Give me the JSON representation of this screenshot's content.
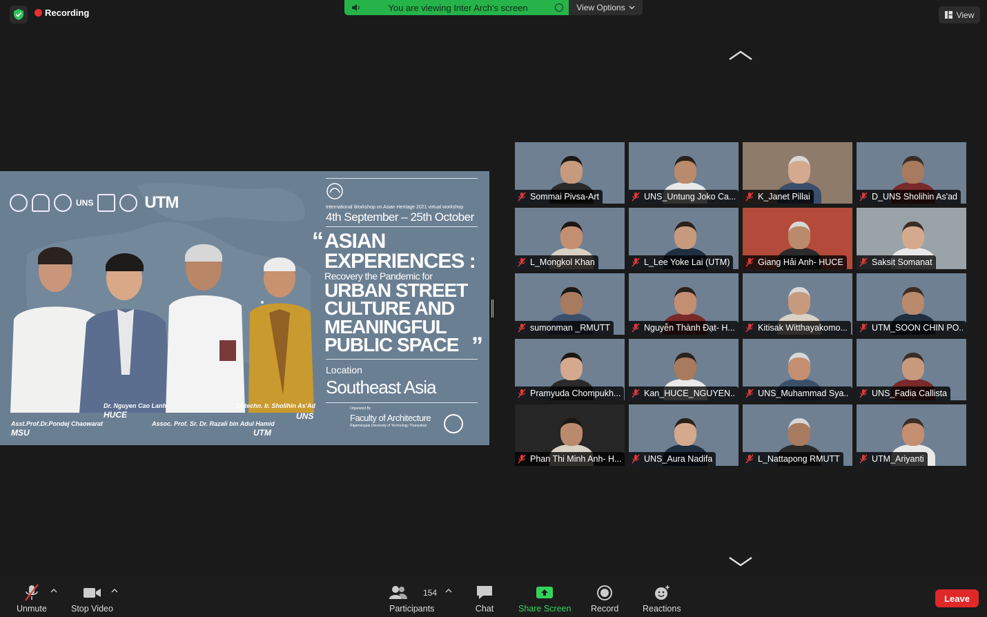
{
  "top": {
    "recording_label": "Recording",
    "share_banner": "You are viewing Inter Arch's screen",
    "view_options": "View Options",
    "view_button": "View"
  },
  "slide": {
    "logo_uns": "UNS",
    "logo_utm": "UTM",
    "workshop_line": "International Workshop on Asian Heritage 2021 virtual workshop",
    "date_start": "4th September",
    "date_sep": "–",
    "date_end": "25th October",
    "title_line1": "ASIAN",
    "title_line2": "EXPERIENCES :",
    "subtitle": "Recovery the Pandemic for",
    "title_line3": "URBAN STREET",
    "title_line4": "CULTURE AND",
    "title_line5": "MEANINGFUL",
    "title_line6": "PUBLIC SPACE",
    "quote_open": "“",
    "quote_close": "”",
    "location_label": "Location",
    "location_value": "Southeast Asia",
    "organized_by": "Organized By",
    "faculty": "Faculty of Architecture",
    "university": "Rajamangala University of Technology Thanyaburi",
    "speakers": [
      {
        "name": "Dr. Nguyen Cao Lanh",
        "org": "HUCE"
      },
      {
        "name": "Dr.techn. Ir. Sholihin As'Ad",
        "org": "UNS"
      },
      {
        "name": "Asst.Prof.Dr.Pondej Chaowarat",
        "org": "MSU"
      },
      {
        "name": "Assoc. Prof. Sr. Dr. Razali bin Adul Hamid",
        "org": "UTM"
      }
    ]
  },
  "participants": [
    {
      "name": "Sommai Pivsa-Art"
    },
    {
      "name": "UNS_Untung Joko Ca..."
    },
    {
      "name": "K_Janet Pillai"
    },
    {
      "name": "D_UNS Sholihin As'ad"
    },
    {
      "name": "L_Mongkol Khan"
    },
    {
      "name": "L_Lee Yoke Lai (UTM)"
    },
    {
      "name": "Giang Hải Anh- HUCE"
    },
    {
      "name": "Saksit Somanat"
    },
    {
      "name": "sumonman _RMUTT"
    },
    {
      "name": "Nguyễn Thành Đạt- H..."
    },
    {
      "name": "Kitisak Witthayakomo..."
    },
    {
      "name": "UTM_SOON CHIN PO..."
    },
    {
      "name": "Pramyuda Chompukh..."
    },
    {
      "name": "Kan_HUCE_NGUYEN..."
    },
    {
      "name": "UNS_Muhammad Sya..."
    },
    {
      "name": "UNS_Fadia Callista"
    },
    {
      "name": "Phan Thi Minh Anh- H..."
    },
    {
      "name": "UNS_Aura Nadifa"
    },
    {
      "name": "L_Nattapong RMUTT"
    },
    {
      "name": "UTM_Ariyanti"
    }
  ],
  "toolbar": {
    "unmute": "Unmute",
    "stop_video": "Stop Video",
    "participants": "Participants",
    "participants_count": "154",
    "chat": "Chat",
    "share_screen": "Share Screen",
    "record": "Record",
    "reactions": "Reactions",
    "leave": "Leave"
  },
  "colors": {
    "share_green": "#26b34a",
    "leave_red": "#e02828",
    "recording_red": "#e8312f",
    "slide_bg": "#6b7f93"
  }
}
